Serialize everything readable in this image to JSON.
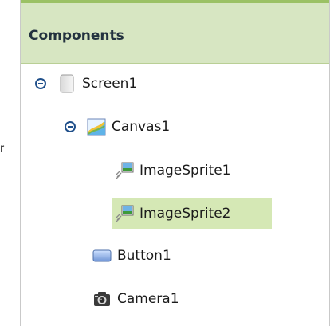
{
  "left_marker": "r",
  "components_panel": {
    "title": "Components",
    "tree": [
      {
        "label": "Screen1",
        "icon": "screen-icon",
        "toggle": "collapse",
        "selected": false
      },
      {
        "label": "Canvas1",
        "icon": "canvas-icon",
        "toggle": "collapse",
        "selected": false
      },
      {
        "label": "ImageSprite1",
        "icon": "image-sprite-icon",
        "toggle": "",
        "selected": false
      },
      {
        "label": "ImageSprite2",
        "icon": "image-sprite-icon",
        "toggle": "",
        "selected": true
      },
      {
        "label": "Button1",
        "icon": "button-icon",
        "toggle": "",
        "selected": false
      },
      {
        "label": "Camera1",
        "icon": "camera-icon",
        "toggle": "",
        "selected": false
      }
    ]
  },
  "colors": {
    "header_bg": "#d7e6c2",
    "accent_line": "#9bc165",
    "selected_row": "#d5e8b5",
    "toggle": "#1f4f8a"
  }
}
